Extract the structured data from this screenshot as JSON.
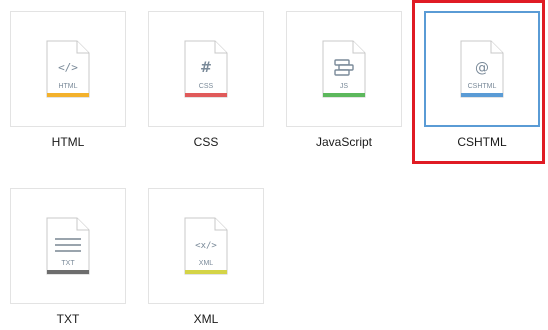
{
  "templates": [
    {
      "label": "HTML",
      "glyph": "</>",
      "tag": "HTML",
      "stripe": "#f3b12c",
      "icon": "html-file-icon"
    },
    {
      "label": "CSS",
      "glyph": "#",
      "tag": "CSS",
      "stripe": "#e05a5a",
      "icon": "css-file-icon"
    },
    {
      "label": "JavaScript",
      "glyph": "",
      "tag": "JS",
      "stripe": "#5cb85c",
      "icon": "js-file-icon"
    },
    {
      "label": "CSHTML",
      "glyph": "@",
      "tag": "CSHTML",
      "stripe": "#5a9bd5",
      "icon": "cshtml-file-icon",
      "selected": true
    },
    {
      "label": "TXT",
      "glyph": "",
      "tag": "TXT",
      "stripe": "#6d6d6d",
      "icon": "txt-file-icon"
    },
    {
      "label": "XML",
      "glyph": "<x/>",
      "tag": "XML",
      "stripe": "#d4d447",
      "icon": "xml-file-icon"
    }
  ],
  "colors": {
    "selection_border": "#5a9bd5",
    "highlight_box": "#e01b24",
    "glyph": "#7a8a99",
    "tag_text": "#7a8a99"
  }
}
